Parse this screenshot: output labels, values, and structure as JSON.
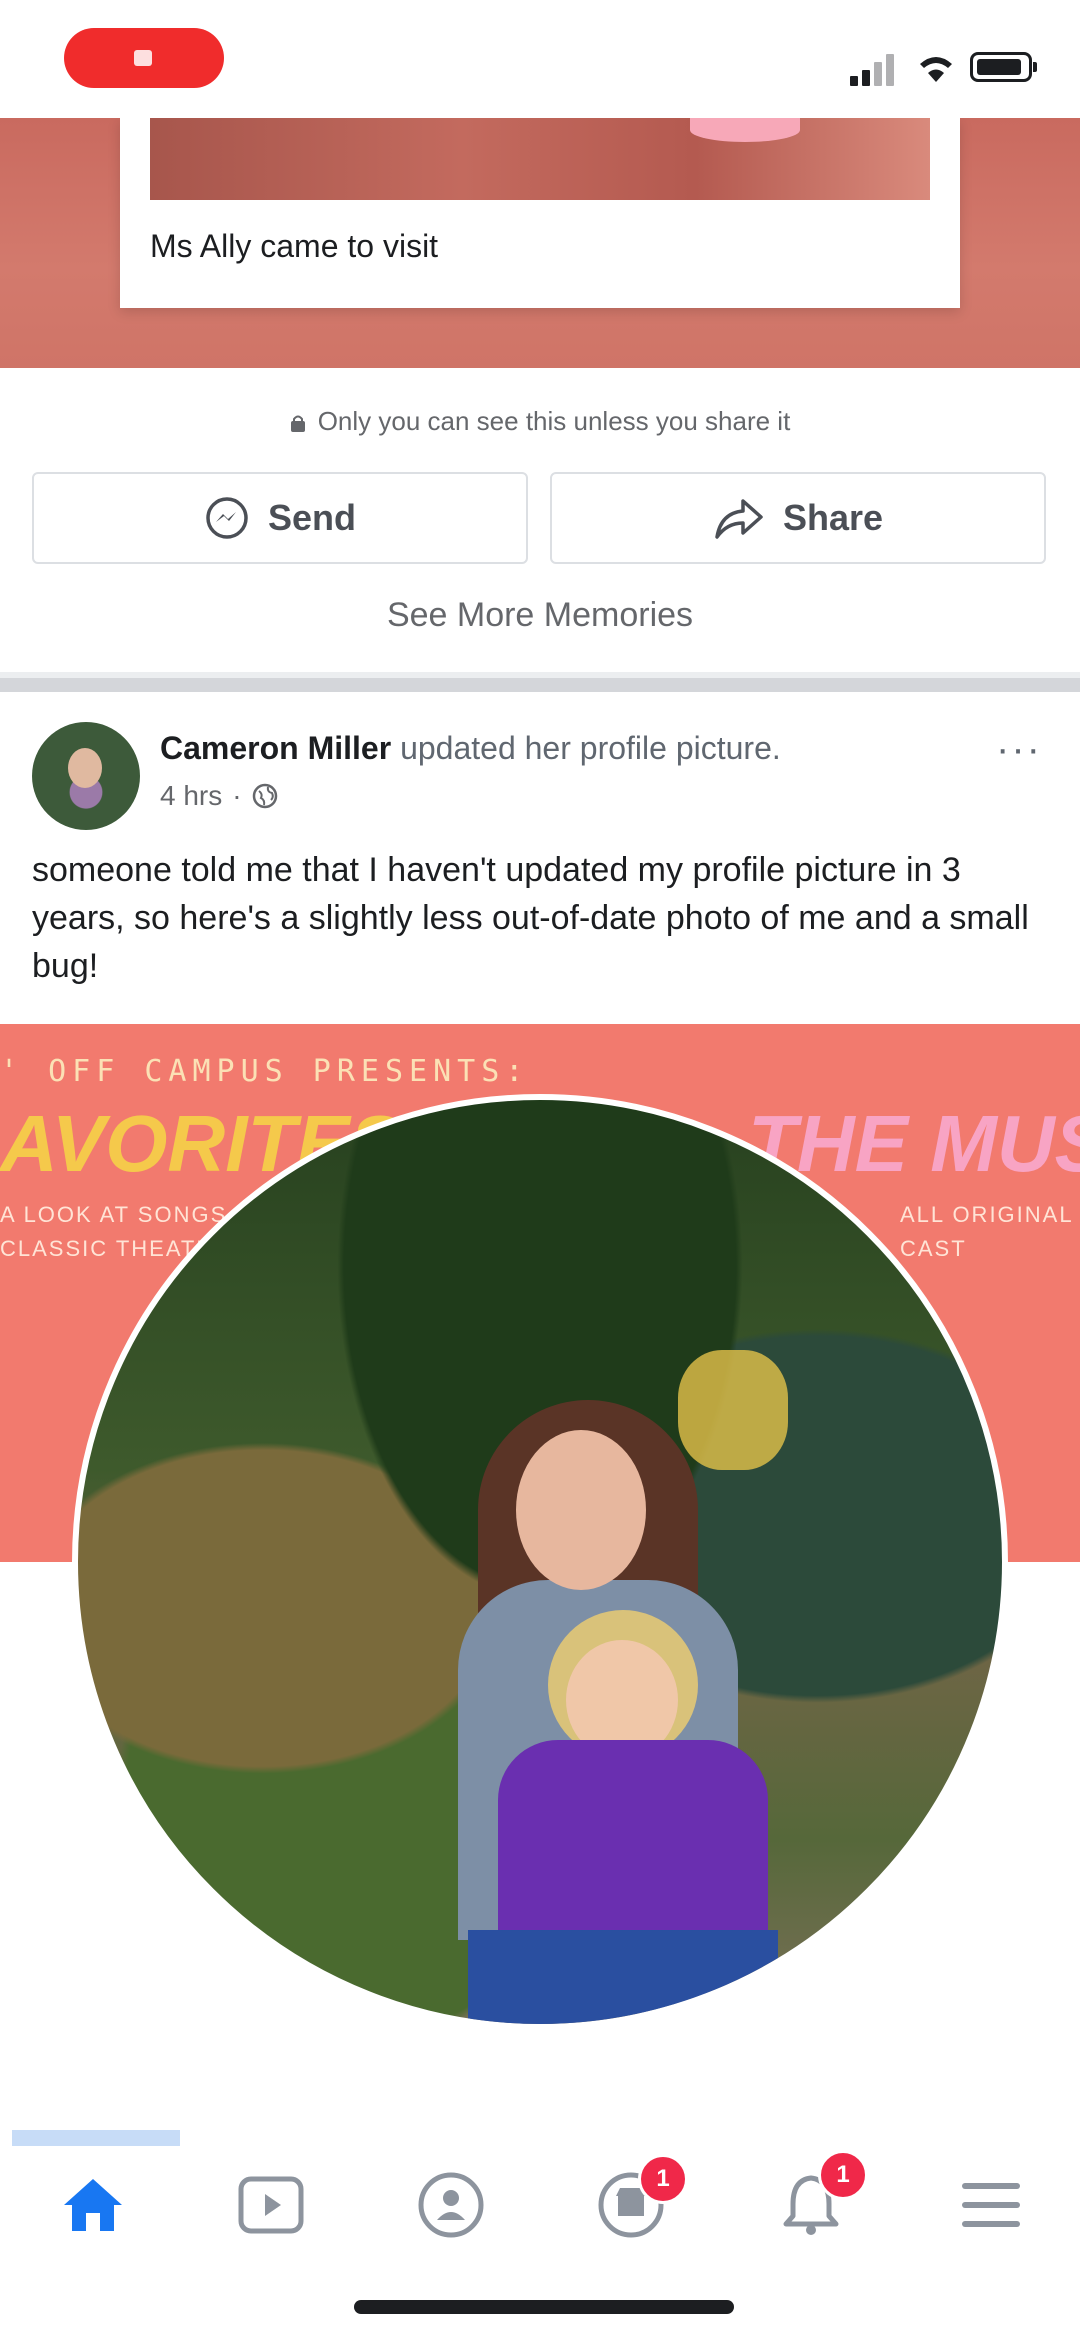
{
  "memory": {
    "caption": "Ms Ally came to visit",
    "privacy_note": "Only you can see this unless you share it",
    "send_label": "Send",
    "share_label": "Share",
    "see_more_label": "See More Memories"
  },
  "post": {
    "author": "Cameron Miller",
    "action": " updated her profile picture.",
    "time": "4 hrs",
    "privacy_icon": "globe-icon",
    "text": "someone told me that I haven't updated my profile picture in 3 years, so here's a slightly less out-of-date photo of me and a small bug!",
    "cover_line": "' OFF CAMPUS PRESENTS:",
    "cover_title_a": "AVORITES II",
    "cover_title_b": "THE MUSIC",
    "cover_small_left": "A LOOK AT SONGS",
    "cover_small_left2": "CLASSIC THEATRE",
    "cover_small_right": "ALL ORIGINAL",
    "cover_small_right2": "CAST"
  },
  "tabbar": {
    "tabs": [
      {
        "name": "home",
        "icon": "home-icon",
        "active": true
      },
      {
        "name": "watch",
        "icon": "watch-icon"
      },
      {
        "name": "groups",
        "icon": "groups-icon"
      },
      {
        "name": "marketplace",
        "icon": "marketplace-icon",
        "badge": "1"
      },
      {
        "name": "notifications",
        "icon": "bell-icon",
        "badge": "1"
      },
      {
        "name": "menu",
        "icon": "menu-icon"
      }
    ],
    "badge_market": "1",
    "badge_notif": "1"
  },
  "colors": {
    "accent": "#1877f2",
    "badge": "#f02849",
    "record": "#f02c2c"
  }
}
